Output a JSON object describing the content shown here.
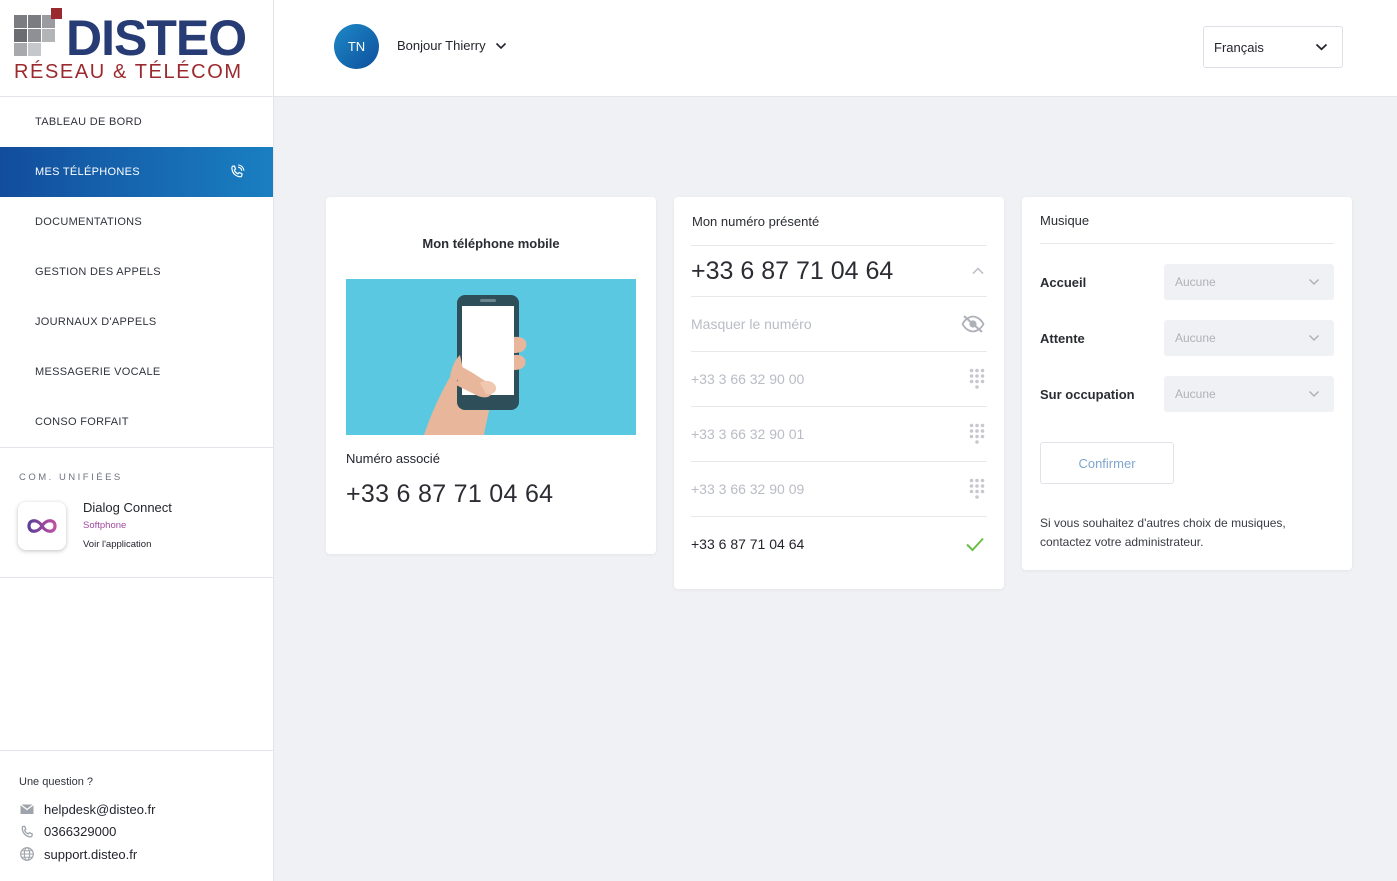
{
  "brand": {
    "name": "DISTEO",
    "tagline": "RÉSEAU & TÉLÉCOM"
  },
  "sidebar": {
    "items": [
      {
        "label": "TABLEAU DE BORD"
      },
      {
        "label": "MES TÉLÉPHONES",
        "active": true,
        "icon": "phone-call-icon"
      },
      {
        "label": "DOCUMENTATIONS"
      },
      {
        "label": "GESTION DES APPELS"
      },
      {
        "label": "JOURNAUX D'APPELS"
      },
      {
        "label": "MESSAGERIE VOCALE"
      },
      {
        "label": "CONSO FORFAIT"
      }
    ],
    "com_title": "COM. UNIFIÉES",
    "app": {
      "name": "Dialog Connect",
      "kind": "Softphone",
      "link": "Voir l'application",
      "icon": "infinity-icon"
    },
    "help": {
      "question": "Une question ?",
      "email": "helpdesk@disteo.fr",
      "phone": "0366329000",
      "site": "support.disteo.fr"
    }
  },
  "header": {
    "avatar_initials": "TN",
    "greeting": "Bonjour Thierry",
    "language": "Français"
  },
  "mobile_card": {
    "title": "Mon téléphone mobile",
    "assoc_label": "Numéro associé",
    "assoc_number": "+33 6 87 71 04 64"
  },
  "presented_card": {
    "title": "Mon numéro présenté",
    "current": "+33 6 87 71 04 64",
    "mask_label": "Masquer le numéro",
    "options": [
      {
        "number": "+33 3 66 32 90 00",
        "icon": "dialpad-icon"
      },
      {
        "number": "+33 3 66 32 90 01",
        "icon": "dialpad-icon"
      },
      {
        "number": "+33 3 66 32 90 09",
        "icon": "dialpad-icon"
      },
      {
        "number": "+33 6 87 71 04 64",
        "icon": "check-icon",
        "selected": true
      }
    ]
  },
  "music_card": {
    "title": "Musique",
    "rows": [
      {
        "label": "Accueil",
        "value": "Aucune"
      },
      {
        "label": "Attente",
        "value": "Aucune"
      },
      {
        "label": "Sur occupation",
        "value": "Aucune"
      }
    ],
    "confirm_label": "Confirmer",
    "note": "Si vous souhaitez d'autres choix de musiques, contactez votre administrateur."
  },
  "colors": {
    "accent": "#1566ad",
    "brand_blue": "#273b75",
    "brand_red": "#9b2a2e",
    "illustration_bg": "#5ac8e1",
    "check": "#6cc04a"
  }
}
